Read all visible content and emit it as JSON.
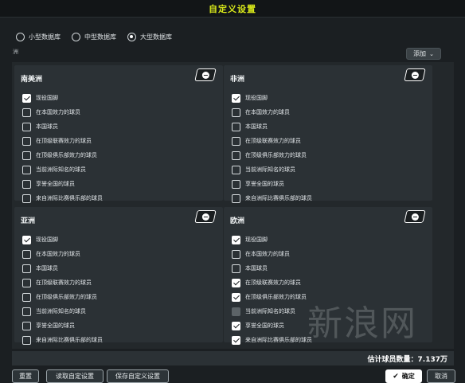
{
  "window": {
    "title": "自定义设置"
  },
  "database_options": [
    {
      "label": "小型数据库",
      "selected": false
    },
    {
      "label": "中型数据库",
      "selected": false
    },
    {
      "label": "大型数据库",
      "selected": true
    }
  ],
  "continent_label": "洲",
  "add_button": {
    "label": "添加",
    "icon": "chevron-down-icon"
  },
  "panels": [
    {
      "title": "南美洲",
      "items": [
        {
          "label": "现役国脚",
          "state": "checked"
        },
        {
          "label": "在本国效力的球员",
          "state": "unchecked"
        },
        {
          "label": "本国球员",
          "state": "unchecked"
        },
        {
          "label": "在顶级联赛效力的球员",
          "state": "unchecked"
        },
        {
          "label": "在顶级俱乐部效力的球员",
          "state": "unchecked"
        },
        {
          "label": "当前洲际知名的球员",
          "state": "unchecked"
        },
        {
          "label": "享誉全国的球员",
          "state": "unchecked"
        },
        {
          "label": "来自洲际比赛俱乐部的球员",
          "state": "unchecked"
        }
      ]
    },
    {
      "title": "非洲",
      "items": [
        {
          "label": "现役国脚",
          "state": "checked"
        },
        {
          "label": "在本国效力的球员",
          "state": "unchecked"
        },
        {
          "label": "本国球员",
          "state": "unchecked"
        },
        {
          "label": "在顶级联赛效力的球员",
          "state": "unchecked"
        },
        {
          "label": "在顶级俱乐部效力的球员",
          "state": "unchecked"
        },
        {
          "label": "当前洲际知名的球员",
          "state": "unchecked"
        },
        {
          "label": "享誉全国的球员",
          "state": "unchecked"
        },
        {
          "label": "来自洲际比赛俱乐部的球员",
          "state": "unchecked"
        }
      ]
    },
    {
      "title": "亚洲",
      "items": [
        {
          "label": "现役国脚",
          "state": "checked"
        },
        {
          "label": "在本国效力的球员",
          "state": "unchecked"
        },
        {
          "label": "本国球员",
          "state": "unchecked"
        },
        {
          "label": "在顶级联赛效力的球员",
          "state": "unchecked"
        },
        {
          "label": "在顶级俱乐部效力的球员",
          "state": "unchecked"
        },
        {
          "label": "当前洲际知名的球员",
          "state": "unchecked"
        },
        {
          "label": "享誉全国的球员",
          "state": "unchecked"
        },
        {
          "label": "来自洲际比赛俱乐部的球员",
          "state": "unchecked"
        }
      ]
    },
    {
      "title": "欧洲",
      "items": [
        {
          "label": "现役国脚",
          "state": "checked"
        },
        {
          "label": "在本国效力的球员",
          "state": "unchecked"
        },
        {
          "label": "本国球员",
          "state": "unchecked"
        },
        {
          "label": "在顶级联赛效力的球员",
          "state": "checked"
        },
        {
          "label": "在顶级俱乐部效力的球员",
          "state": "checked"
        },
        {
          "label": "当前洲际知名的球员",
          "state": "disabled"
        },
        {
          "label": "享誉全国的球员",
          "state": "checked"
        },
        {
          "label": "来自洲际比赛俱乐部的球员",
          "state": "checked"
        }
      ]
    }
  ],
  "status": {
    "estimate": "估计球员数量：7.137万"
  },
  "footer": {
    "reset": "重置",
    "load": "读取自定设置",
    "save": "保存自定义设置",
    "ok": "确定",
    "cancel": "取消"
  },
  "watermark": "新浪网"
}
